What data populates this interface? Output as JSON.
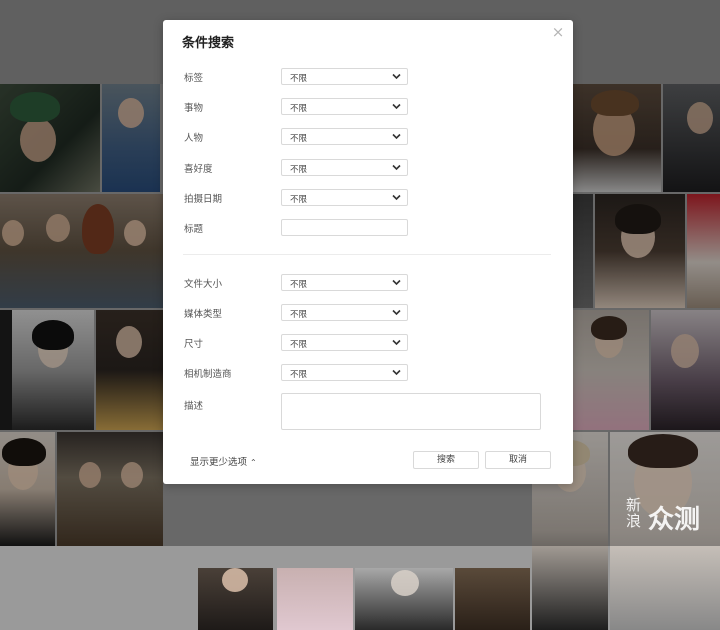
{
  "dialog": {
    "title": "条件搜索",
    "close_glyph": "×",
    "fields": [
      {
        "label": "标签",
        "value": "不限"
      },
      {
        "label": "事物",
        "value": "不限"
      },
      {
        "label": "人物",
        "value": "不限"
      },
      {
        "label": "喜好度",
        "value": "不限"
      },
      {
        "label": "拍摄日期",
        "value": "不限"
      },
      {
        "label": "标题",
        "value": ""
      },
      {
        "label": "文件大小",
        "value": "不限"
      },
      {
        "label": "媒体类型",
        "value": "不限"
      },
      {
        "label": "尺寸",
        "value": "不限"
      },
      {
        "label": "相机制造商",
        "value": "不限"
      },
      {
        "label": "描述",
        "value": ""
      }
    ],
    "toggle_link": "显示更少选项",
    "toggle_caret": "⌃",
    "search_button": "搜索",
    "cancel_button": "取消"
  },
  "watermark": {
    "small": "新浪",
    "big": "众测"
  },
  "colors": {
    "accent": "#ffffff",
    "border": "#d9d9d9"
  }
}
